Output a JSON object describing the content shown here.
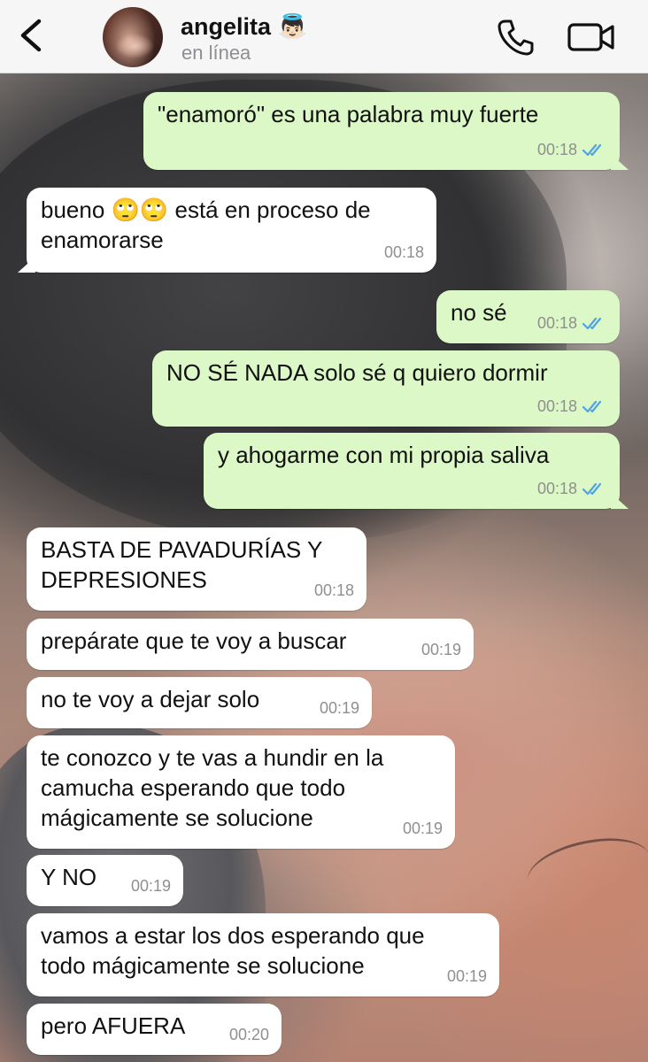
{
  "header": {
    "contact_name": "angelita 👼🏻",
    "status": "en línea",
    "icons": {
      "back": "chevron-left-icon",
      "call": "phone-icon",
      "video": "video-camera-icon"
    }
  },
  "colors": {
    "incoming_bubble": "#ffffff",
    "outgoing_bubble": "#dcf8c6",
    "read_ticks": "#4fa3e6",
    "header_bg": "#f6f6f6"
  },
  "messages": [
    {
      "direction": "out",
      "text": "\"enamoró\" es una palabra muy fuerte",
      "time": "00:18",
      "read": true
    },
    {
      "direction": "in",
      "text": "bueno 🙄🙄 está en proceso de\nenamorarse",
      "time": "00:18"
    },
    {
      "direction": "out",
      "text": "no sé",
      "time": "00:18",
      "read": true
    },
    {
      "direction": "out",
      "text": "NO SÉ NADA solo sé q quiero dormir",
      "time": "00:18",
      "read": true
    },
    {
      "direction": "out",
      "text": "y ahogarme con mi propia saliva",
      "time": "00:18",
      "read": true
    },
    {
      "direction": "in",
      "text": "BASTA DE PAVADURÍAS Y\nDEPRESIONES",
      "time": "00:18"
    },
    {
      "direction": "in",
      "text": "prepárate que te voy a buscar",
      "time": "00:19"
    },
    {
      "direction": "in",
      "text": "no te voy a dejar solo",
      "time": "00:19"
    },
    {
      "direction": "in",
      "text": "te conozco y te vas a hundir en la\ncamucha esperando que todo\nmágicamente se solucione",
      "time": "00:19"
    },
    {
      "direction": "in",
      "text": "Y NO",
      "time": "00:19"
    },
    {
      "direction": "in",
      "text": "vamos a estar los dos esperando que\ntodo mágicamente se solucione",
      "time": "00:19"
    },
    {
      "direction": "in",
      "text": "pero AFUERA",
      "time": "00:20"
    }
  ]
}
